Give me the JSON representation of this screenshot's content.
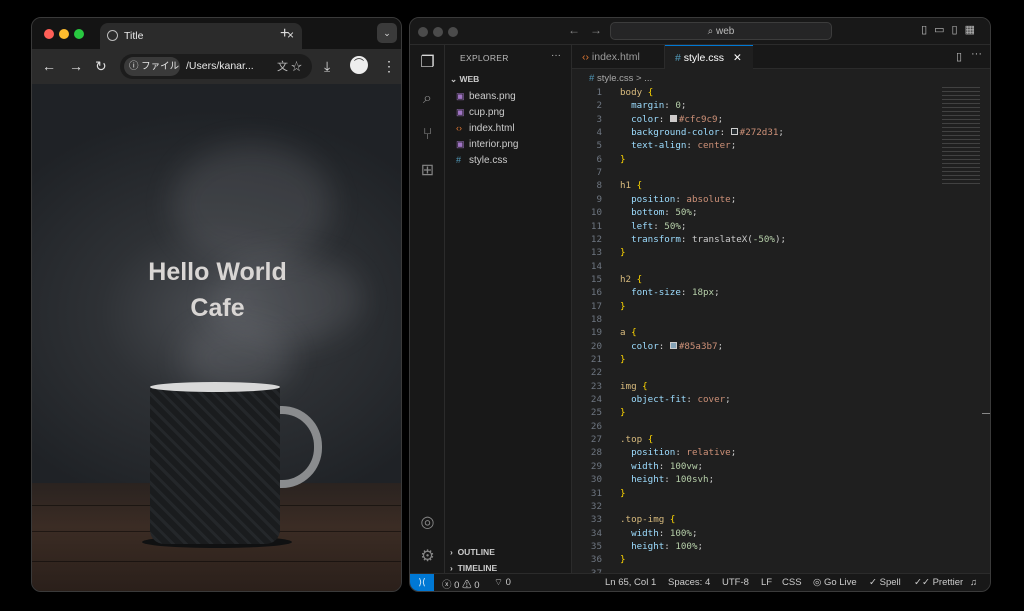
{
  "browser": {
    "tab_title": "Title",
    "tab_close": "×",
    "new_tab": "+",
    "tab_menu": "⌄",
    "chip_label": "ファイル",
    "url": "/Users/kanar...",
    "page_title_line1": "Hello World",
    "page_title_line2": "Cafe"
  },
  "vscode": {
    "command_center": "web",
    "explorer_title": "EXPLORER",
    "folder": "WEB",
    "files": [
      {
        "name": "beans.png",
        "icon": "image-icon"
      },
      {
        "name": "cup.png",
        "icon": "image-icon"
      },
      {
        "name": "index.html",
        "icon": "html-icon"
      },
      {
        "name": "interior.png",
        "icon": "image-icon"
      },
      {
        "name": "style.css",
        "icon": "css-icon"
      }
    ],
    "outline": "OUTLINE",
    "timeline": "TIMELINE",
    "tabs": {
      "index": "index.html",
      "style": "style.css"
    },
    "breadcrumb": "style.css  >  ...",
    "status": {
      "problems": "0",
      "warnings": "0",
      "ports": "0",
      "position": "Ln 65, Col 1",
      "spaces": "Spaces: 4",
      "encoding": "UTF-8",
      "eol": "LF",
      "language": "CSS",
      "golive": "Go Live",
      "spell": "Spell",
      "prettier": "Prettier"
    }
  },
  "code_lines": [
    {
      "n": "1",
      "html": "<span class='sel'>body</span> <span class='brace'>{</span>"
    },
    {
      "n": "2",
      "html": "  <span class='prop'>margin</span>: <span class='num'>0</span>;"
    },
    {
      "n": "3",
      "html": "  <span class='prop'>color</span>: <span class='swatch' style='background:#cfc9c9'></span><span class='val'>#cfc9c9</span>;"
    },
    {
      "n": "4",
      "html": "  <span class='prop'>background-color</span>: <span class='swatch' style='background:#272d31'></span><span class='val'>#272d31</span>;"
    },
    {
      "n": "5",
      "html": "  <span class='prop'>text-align</span>: <span class='val'>center</span>;"
    },
    {
      "n": "6",
      "html": "<span class='brace'>}</span>"
    },
    {
      "n": "7",
      "html": ""
    },
    {
      "n": "8",
      "html": "<span class='sel'>h1</span> <span class='brace'>{</span>"
    },
    {
      "n": "9",
      "html": "  <span class='prop'>position</span>: <span class='val'>absolute</span>;"
    },
    {
      "n": "10",
      "html": "  <span class='prop'>bottom</span>: <span class='num'>50%</span>;"
    },
    {
      "n": "11",
      "html": "  <span class='prop'>left</span>: <span class='num'>50%</span>;"
    },
    {
      "n": "12",
      "html": "  <span class='prop'>transform</span>: translateX(<span class='num'>-50%</span>);"
    },
    {
      "n": "13",
      "html": "<span class='brace'>}</span>"
    },
    {
      "n": "14",
      "html": ""
    },
    {
      "n": "15",
      "html": "<span class='sel'>h2</span> <span class='brace'>{</span>"
    },
    {
      "n": "16",
      "html": "  <span class='prop'>font-size</span>: <span class='num'>18px</span>;"
    },
    {
      "n": "17",
      "html": "<span class='brace'>}</span>"
    },
    {
      "n": "18",
      "html": ""
    },
    {
      "n": "19",
      "html": "<span class='sel'>a</span> <span class='brace'>{</span>"
    },
    {
      "n": "20",
      "html": "  <span class='prop'>color</span>: <span class='swatch' style='background:#85a3b7'></span><span class='val'>#85a3b7</span>;"
    },
    {
      "n": "21",
      "html": "<span class='brace'>}</span>"
    },
    {
      "n": "22",
      "html": ""
    },
    {
      "n": "23",
      "html": "<span class='sel'>img</span> <span class='brace'>{</span>"
    },
    {
      "n": "24",
      "html": "  <span class='prop'>object-fit</span>: <span class='val'>cover</span>;"
    },
    {
      "n": "25",
      "html": "<span class='brace'>}</span>"
    },
    {
      "n": "26",
      "html": ""
    },
    {
      "n": "27",
      "html": "<span class='sel'>.top</span> <span class='brace'>{</span>"
    },
    {
      "n": "28",
      "html": "  <span class='prop'>position</span>: <span class='val'>relative</span>;"
    },
    {
      "n": "29",
      "html": "  <span class='prop'>width</span>: <span class='num'>100vw</span>;"
    },
    {
      "n": "30",
      "html": "  <span class='prop'>height</span>: <span class='num'>100svh</span>;"
    },
    {
      "n": "31",
      "html": "<span class='brace'>}</span>"
    },
    {
      "n": "32",
      "html": ""
    },
    {
      "n": "33",
      "html": "<span class='sel'>.top-img</span> <span class='brace'>{</span>"
    },
    {
      "n": "34",
      "html": "  <span class='prop'>width</span>: <span class='num'>100%</span>;"
    },
    {
      "n": "35",
      "html": "  <span class='prop'>height</span>: <span class='num'>100%</span>;"
    },
    {
      "n": "36",
      "html": "<span class='brace'>}</span>"
    },
    {
      "n": "37",
      "html": ""
    }
  ]
}
